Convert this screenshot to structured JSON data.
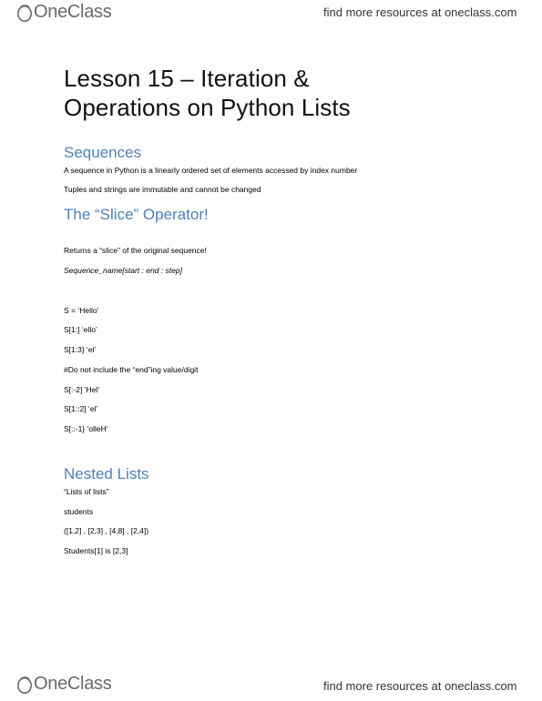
{
  "header": {
    "logo_text": "OneClass",
    "resources_link": "find more resources at oneclass.com"
  },
  "footer": {
    "logo_text": "OneClass",
    "resources_link": "find more resources at oneclass.com"
  },
  "document": {
    "title_line1": "Lesson 15 – Iteration &",
    "title_line2": "Operations on Python Lists",
    "sections": {
      "sequences": {
        "heading": "Sequences",
        "lines": [
          "A sequence in Python is a linearly ordered set of elements accessed by index number",
          "Tuples and strings are immutable and cannot be changed"
        ]
      },
      "slice": {
        "heading": "The “Slice” Operator!",
        "lines": [
          "Returns a “slice” of the original sequence!",
          "Sequence_name[start : end : step]",
          "S = ‘Hello’",
          "S[1:] ‘ello’",
          "S[1:3} ‘el’",
          "#Do not include the “end”ing value/digit",
          "S[:-2] ‘Hel’",
          "S[1::2] ‘el’",
          "S[::-1} ‘olleH’"
        ]
      },
      "nested": {
        "heading": "Nested Lists",
        "lines": [
          "“Lists of lists”",
          "students",
          "([1,2] , [2,3] , [4,8] , [2,4])",
          "Students[1] is [2,3]"
        ]
      }
    }
  }
}
